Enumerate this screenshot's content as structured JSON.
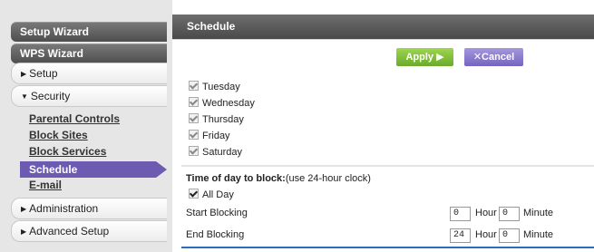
{
  "sidebar": {
    "setup_wizard": "Setup Wizard",
    "wps_wizard": "WPS Wizard",
    "setup": "Setup",
    "security": "Security",
    "security_items": [
      "Parental Controls",
      "Block Sites",
      "Block Services",
      "Schedule",
      "E-mail"
    ],
    "administration": "Administration",
    "advanced_setup": "Advanced Setup"
  },
  "header": {
    "title": "Schedule"
  },
  "toolbar": {
    "apply_label": "Apply ▶",
    "cancel_label": "✕Cancel"
  },
  "days": [
    {
      "label": "Tuesday",
      "checked": true
    },
    {
      "label": "Wednesday",
      "checked": true
    },
    {
      "label": "Thursday",
      "checked": true
    },
    {
      "label": "Friday",
      "checked": true
    },
    {
      "label": "Saturday",
      "checked": true
    }
  ],
  "time_block": {
    "title_bold": "Time of day to block:",
    "title_rest": "(use 24-hour clock)",
    "all_day_label": "All Day",
    "start_label": "Start Blocking",
    "end_label": "End Blocking",
    "start_hour": "0",
    "start_minute": "0",
    "end_hour": "24",
    "end_minute": "0",
    "hour_unit": "Hour",
    "minute_unit": "Minute"
  },
  "colors": {
    "accent_purple": "#6c5bb0",
    "apply_green": "#7bbb35",
    "header_gray": "#5a5a5a"
  }
}
